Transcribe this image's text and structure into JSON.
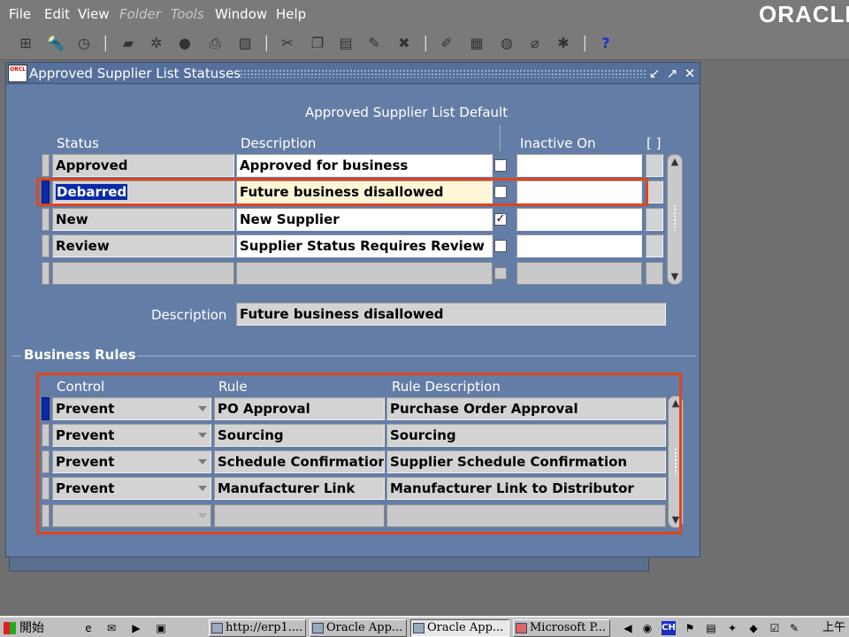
{
  "menu": {
    "items": [
      {
        "label": "File",
        "enabled": true
      },
      {
        "label": "Edit",
        "enabled": true
      },
      {
        "label": "View",
        "enabled": true
      },
      {
        "label": "Folder",
        "enabled": false
      },
      {
        "label": "Tools",
        "enabled": false
      },
      {
        "label": "Window",
        "enabled": true
      },
      {
        "label": "Help",
        "enabled": true
      }
    ],
    "brand": "ORACLE"
  },
  "toolbar": {
    "icons": [
      "new-record-icon",
      "find-icon",
      "navigator-icon",
      "save-icon",
      "next-step-icon",
      "switch-responsibility-icon",
      "print-icon",
      "close-form-icon",
      "cut-icon",
      "copy-icon",
      "paste-icon",
      "clear-record-icon",
      "delete-record-icon",
      "edit-field-icon",
      "zoom-icon",
      "translations-icon",
      "attachments-icon",
      "folder-tools-icon",
      "help-icon"
    ]
  },
  "window": {
    "title": "Approved Supplier List Statuses",
    "group_header": "Approved Supplier List Default",
    "status_table": {
      "headers": {
        "status": "Status",
        "description": "Description",
        "inactive_on": "Inactive On",
        "flex": "[ ]"
      },
      "rows": [
        {
          "status": "Approved",
          "description": "Approved for business",
          "default": false,
          "inactive_on": ""
        },
        {
          "status": "Debarred",
          "description": "Future business disallowed",
          "default": false,
          "inactive_on": "",
          "current": true
        },
        {
          "status": "New",
          "description": "New Supplier",
          "default": true,
          "inactive_on": ""
        },
        {
          "status": "Review",
          "description": "Supplier Status Requires Review",
          "default": false,
          "inactive_on": ""
        },
        {
          "status": "",
          "description": "",
          "default": false,
          "inactive_on": "",
          "empty": true
        }
      ]
    },
    "description_field": {
      "label": "Description",
      "value": "Future business disallowed"
    },
    "business_rules": {
      "title": "Business Rules",
      "headers": {
        "control": "Control",
        "rule": "Rule",
        "rule_description": "Rule Description"
      },
      "rows": [
        {
          "control": "Prevent",
          "rule": "PO Approval",
          "rule_description": "Purchase Order Approval"
        },
        {
          "control": "Prevent",
          "rule": "Sourcing",
          "rule_description": "Sourcing"
        },
        {
          "control": "Prevent",
          "rule": "Schedule Confirmation",
          "rule_description": "Supplier Schedule Confirmation"
        },
        {
          "control": "Prevent",
          "rule": "Manufacturer Link",
          "rule_description": "Manufacturer Link to Distributor"
        },
        {
          "control": "",
          "rule": "",
          "rule_description": "",
          "empty": true
        }
      ]
    }
  },
  "taskbar": {
    "start_label": "開始",
    "tasks": [
      {
        "label": "http://erp1....",
        "active": false
      },
      {
        "label": "Oracle App...",
        "active": false
      },
      {
        "label": "Oracle App...",
        "active": true
      },
      {
        "label": "Microsoft P...",
        "active": false
      }
    ],
    "clock": "上午"
  },
  "colors": {
    "window_bg": "#637da6",
    "highlight": "#e0451c",
    "selection": "#0a2aa8",
    "current_row_field": "#fff6d7"
  }
}
